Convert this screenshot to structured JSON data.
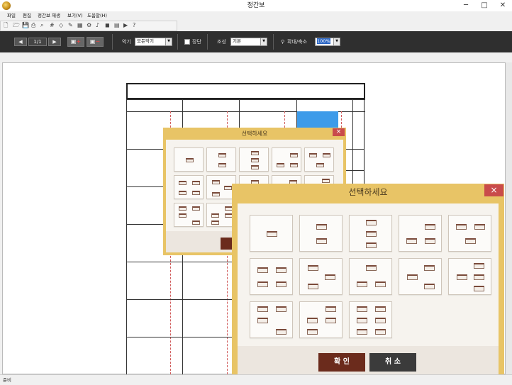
{
  "window": {
    "title": "정간보",
    "minimize": "─",
    "maximize": "□",
    "close": "✕"
  },
  "menu": [
    "파일",
    "편집",
    "정간보 재생",
    "보기(V)",
    "도움말(H)"
  ],
  "toolbar": {
    "page": "1/1",
    "instrument_label": "악기",
    "instrument_value": "모든악기",
    "jangdan_label": "장단",
    "key_label": "조성",
    "key_value": "기본",
    "zoom_label": "확대/축소",
    "zoom_value": "100%"
  },
  "status": "준비",
  "dialog_small": {
    "title": "선택하세요",
    "close": "×"
  },
  "dialog_large": {
    "title": "선택하세요",
    "close": "×",
    "ok": "확 인",
    "cancel": "취 소"
  }
}
